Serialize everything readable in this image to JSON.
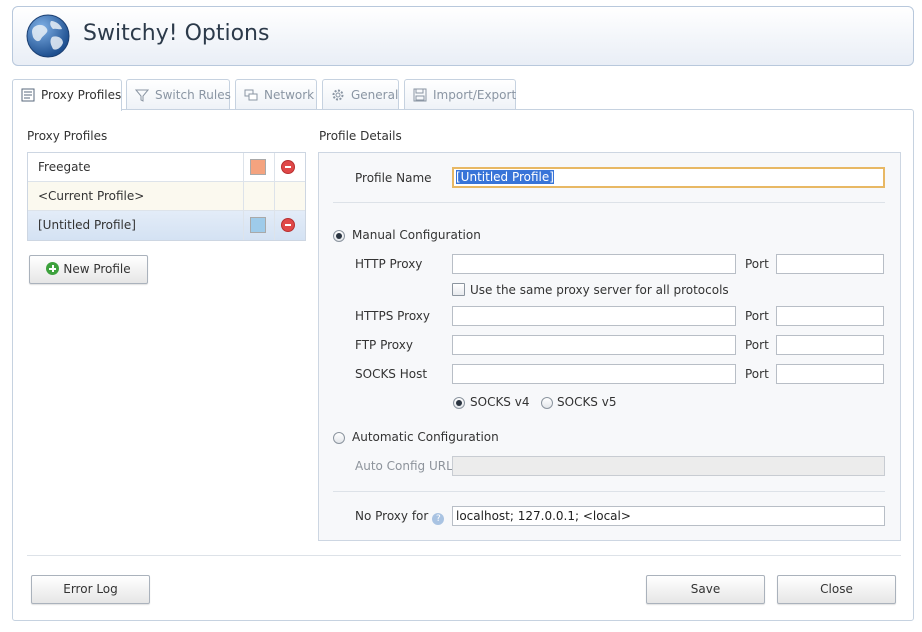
{
  "app": {
    "title": "Switchy! Options"
  },
  "tabs": [
    {
      "label": "Proxy Profiles",
      "icon": "profile-icon",
      "active": true
    },
    {
      "label": "Switch Rules",
      "icon": "filter-icon",
      "active": false
    },
    {
      "label": "Network",
      "icon": "network-icon",
      "active": false
    },
    {
      "label": "General",
      "icon": "gear-icon",
      "active": false
    },
    {
      "label": "Import/Export",
      "icon": "disk-icon",
      "active": false
    }
  ],
  "profiles": {
    "title": "Proxy Profiles",
    "items": [
      {
        "name": "Freegate",
        "color": "#f4a37f"
      },
      {
        "name": "<Current Profile>",
        "color": ""
      },
      {
        "name": "[Untitled Profile]",
        "color": "#9ecbea"
      }
    ],
    "new_label": "New Profile"
  },
  "details": {
    "title": "Profile Details",
    "profile_name_label": "Profile Name",
    "profile_name_value": "[Untitled Profile]",
    "manual_label": "Manual Configuration",
    "http_label": "HTTP Proxy",
    "https_label": "HTTPS Proxy",
    "ftp_label": "FTP Proxy",
    "socks_label": "SOCKS Host",
    "port_label": "Port",
    "same_proxy_label": "Use the same proxy server for all protocols",
    "socks_v4_label": "SOCKS v4",
    "socks_v5_label": "SOCKS v5",
    "auto_label": "Automatic Configuration",
    "auto_url_label": "Auto Config URL",
    "no_proxy_label": "No Proxy for",
    "no_proxy_value": "localhost; 127.0.0.1; <local>"
  },
  "footer": {
    "error_log_label": "Error Log",
    "save_label": "Save",
    "close_label": "Close"
  }
}
